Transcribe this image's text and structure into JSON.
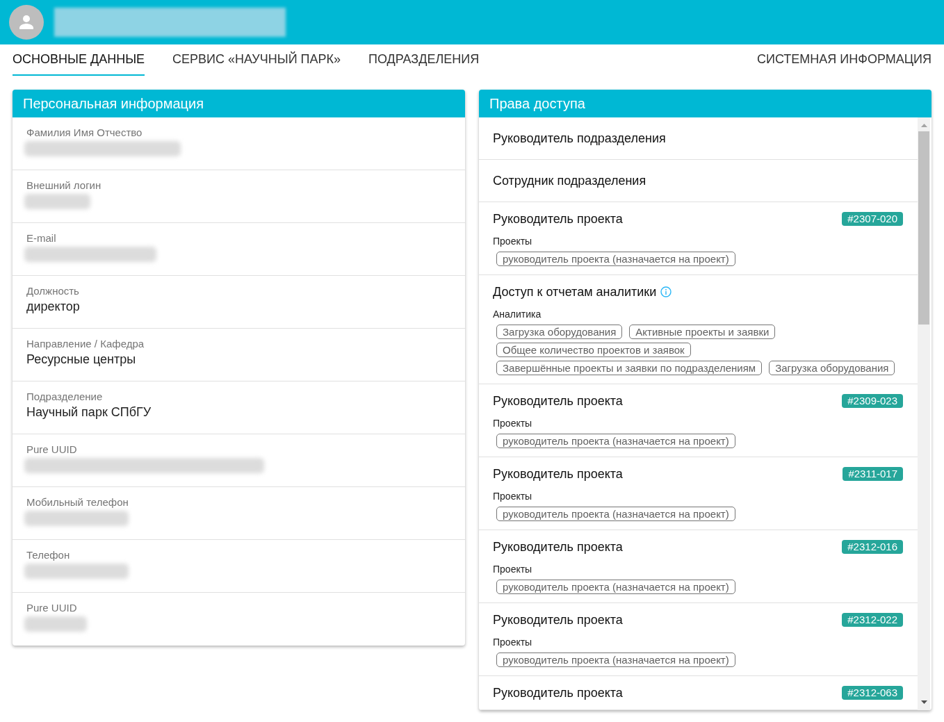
{
  "header": {
    "name_redacted": true
  },
  "tabs": [
    {
      "label": "ОСНОВНЫЕ ДАННЫЕ",
      "selected": true
    },
    {
      "label": "СЕРВИС «НАУЧНЫЙ ПАРК»",
      "selected": false
    },
    {
      "label": "ПОДРАЗДЕЛЕНИЯ",
      "selected": false
    }
  ],
  "end_tabs": [
    {
      "label": "СИСТЕМНАЯ ИНФОРМАЦИЯ",
      "selected": false
    }
  ],
  "personal_info": {
    "title": "Персональная информация",
    "fields": [
      {
        "label": "Фамилия Имя Отчество",
        "redacted": true
      },
      {
        "label": "Внешний логин",
        "redacted": true
      },
      {
        "label": "E-mail",
        "redacted": true
      },
      {
        "label": "Должность",
        "value": "директор",
        "redacted": false
      },
      {
        "label": "Направление / Кафедра",
        "value": "Ресурсные центры",
        "redacted": false
      },
      {
        "label": "Подразделение",
        "value": "Научный парк СПбГУ",
        "redacted": false
      },
      {
        "label": "Pure UUID",
        "redacted": true
      },
      {
        "label": "Мобильный телефон",
        "redacted": true
      },
      {
        "label": "Телефон",
        "redacted": true
      },
      {
        "label": "Pure UUID",
        "redacted": true
      }
    ]
  },
  "access_rights": {
    "title": "Права доступа",
    "items": [
      {
        "kind": "role",
        "title": "Руководитель подразделения"
      },
      {
        "kind": "role",
        "title": "Сотрудник подразделения"
      },
      {
        "kind": "project",
        "title": "Руководитель проекта",
        "badge": "#2307-020",
        "group_label": "Проекты",
        "chips": [
          "руководитель проекта (назначается на проект)"
        ]
      },
      {
        "kind": "analytics",
        "title": "Доступ к отчетам аналитики",
        "group_label": "Аналитика",
        "chips": [
          "Загрузка оборудования",
          "Активные проекты и заявки",
          "Общее количество проектов и заявок",
          "Завершённые проекты и заявки по подразделениям",
          "Загрузка оборудования"
        ]
      },
      {
        "kind": "project",
        "title": "Руководитель проекта",
        "badge": "#2309-023",
        "group_label": "Проекты",
        "chips": [
          "руководитель проекта (назначается на проект)"
        ]
      },
      {
        "kind": "project",
        "title": "Руководитель проекта",
        "badge": "#2311-017",
        "group_label": "Проекты",
        "chips": [
          "руководитель проекта (назначается на проект)"
        ]
      },
      {
        "kind": "project",
        "title": "Руководитель проекта",
        "badge": "#2312-016",
        "group_label": "Проекты",
        "chips": [
          "руководитель проекта (назначается на проект)"
        ]
      },
      {
        "kind": "project",
        "title": "Руководитель проекта",
        "badge": "#2312-022",
        "group_label": "Проекты",
        "chips": [
          "руководитель проекта (назначается на проект)"
        ]
      },
      {
        "kind": "project",
        "title": "Руководитель проекта",
        "badge": "#2312-063"
      }
    ]
  }
}
